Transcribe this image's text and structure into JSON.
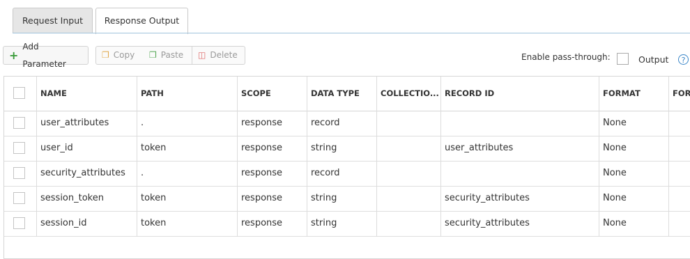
{
  "tabs": [
    {
      "label": "Request Input"
    },
    {
      "label": "Response Output"
    }
  ],
  "toolbar": {
    "add_label": "Add Parameter",
    "copy_label": "Copy",
    "paste_label": "Paste",
    "delete_label": "Delete",
    "passthrough_label": "Enable pass-through:",
    "output_label": "Output",
    "help_label": "?"
  },
  "table": {
    "columns": [
      "NAME",
      "PATH",
      "SCOPE",
      "DATA TYPE",
      "COLLECTIO...",
      "RECORD ID",
      "FORMAT",
      "FORI"
    ],
    "rows": [
      {
        "name": "user_attributes",
        "path": ".",
        "scope": "response",
        "type": "record",
        "collection": "",
        "record_id": "",
        "format": "None"
      },
      {
        "name": "user_id",
        "path": "token",
        "scope": "response",
        "type": "string",
        "collection": "",
        "record_id": "user_attributes",
        "format": "None"
      },
      {
        "name": "security_attributes",
        "path": ".",
        "scope": "response",
        "type": "record",
        "collection": "",
        "record_id": "",
        "format": "None"
      },
      {
        "name": "session_token",
        "path": "token",
        "scope": "response",
        "type": "string",
        "collection": "",
        "record_id": "security_attributes",
        "format": "None"
      },
      {
        "name": "session_id",
        "path": "token",
        "scope": "response",
        "type": "string",
        "collection": "",
        "record_id": "security_attributes",
        "format": "None"
      }
    ]
  }
}
